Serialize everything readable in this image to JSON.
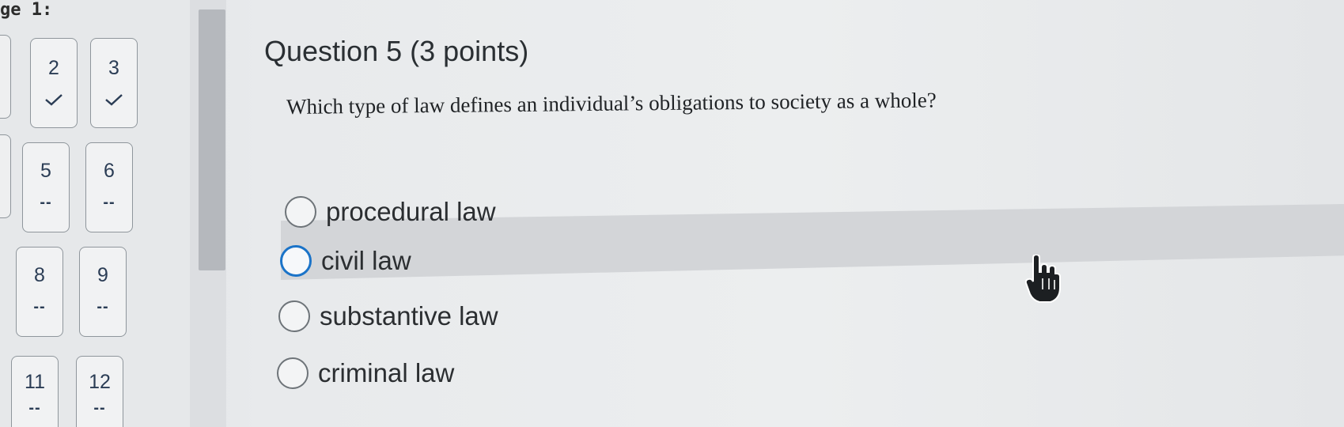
{
  "nav": {
    "heading": "ge 1:",
    "tiles": [
      {
        "number": "2",
        "status": "✓",
        "answered": true
      },
      {
        "number": "3",
        "status": "✓",
        "answered": true
      },
      {
        "number": "5",
        "status": "--",
        "answered": false
      },
      {
        "number": "6",
        "status": "--",
        "answered": false
      },
      {
        "number": "8",
        "status": "--",
        "answered": false
      },
      {
        "number": "9",
        "status": "--",
        "answered": false
      },
      {
        "number": "11",
        "status": "--",
        "answered": false
      },
      {
        "number": "12",
        "status": "--",
        "answered": false
      }
    ]
  },
  "question": {
    "title": "Question 5 (3 points)",
    "text": "Which type of law defines an individual’s obligations to society as a whole?",
    "options": [
      {
        "label": "procedural law",
        "selected": false
      },
      {
        "label": "civil law",
        "selected": false,
        "focused": true
      },
      {
        "label": "substantive law",
        "selected": false
      },
      {
        "label": "criminal law",
        "selected": false
      }
    ]
  },
  "colors": {
    "accent": "#1a73c8",
    "tile_text": "#2b3d55",
    "hover_row": "#d3d5d8"
  },
  "icons": {
    "answered": "checkmark-icon",
    "cursor": "hand-pointer-icon"
  }
}
